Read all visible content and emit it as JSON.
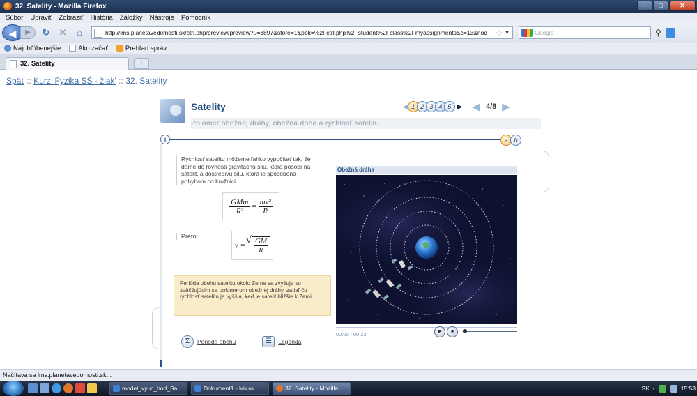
{
  "window": {
    "title": "32. Satelity - Mozilla Firefox"
  },
  "menu": [
    "Súbor",
    "Upraviť",
    "Zobraziť",
    "História",
    "Záložky",
    "Nástroje",
    "Pomocník"
  ],
  "nav": {
    "url": "http://lms.planetavedomosti.sk/ctrl.php/preview/preview?u=3897&store=1&pbk=%2Fctrl.php%2Fstudent%2Fclass%2Fmyassignments&c=13&nod",
    "search_placeholder": "Google"
  },
  "bookmarks": [
    "Najobľúbenejšie",
    "Ako začať",
    "Prehľad správ"
  ],
  "tab": {
    "title": "32. Satelity",
    "new_tab": "+"
  },
  "breadcrumb": {
    "back": "Späť",
    "sep1": "::",
    "course": "Kurz 'Fyzika SŠ - žiak'",
    "sep2": "::",
    "current": "32. Satelity"
  },
  "module": {
    "title": "Satelity",
    "subtitle": "Polomer obežnej dráhy, obežná doba a rýchlosť satelitu",
    "pages": [
      "1",
      "2",
      "3",
      "4",
      "5"
    ],
    "page_count": "4/8",
    "subtabs": [
      "a",
      "b"
    ],
    "info": "i",
    "paragraph": "Rýchlosť satelitu môžeme ľahko vypočítať tak, že dáme do rovnosti gravitačnú silu, ktorá pôsobí na satelit, a dostredivú silu, ktorá je spôsobená pohybom po kružnici.",
    "formula1": {
      "lhs_num": "GMm",
      "lhs_den": "R²",
      "eq": "=",
      "rhs_num": "mv²",
      "rhs_den": "R"
    },
    "preto": "Preto:",
    "formula2": {
      "lhs": "v =",
      "num": "GM",
      "den": "R"
    },
    "note": "Perióda obehu satelitu okolo Zeme sa zvyšuje so zväčšujúcim sa polomerom obežnej dráhy, zatiaľ čo rýchlosť satelitu je vyššia, keď je satelit bližšie k Zemi.",
    "buttons": {
      "period": "Perióda obehu",
      "period_icon": "Σ",
      "legend": "Legenda",
      "legend_icon": "☰"
    },
    "orbit": {
      "label": "Obežná dráha",
      "time": "00:00 | 00:22"
    }
  },
  "status": "Načítava sa lms.planetavedomosti.sk...",
  "taskbar": {
    "buttons": [
      "model_vyuc_hod_Sa...",
      "Dokument1 - Micro...",
      "32. Satelity - Mozilla..."
    ],
    "lang": "SK",
    "clock": "15:53"
  },
  "colors": {
    "link": "#3f6fa6",
    "title_blue": "#1f4e84",
    "note_bg": "#fbecc9",
    "space": "#0e1230"
  }
}
